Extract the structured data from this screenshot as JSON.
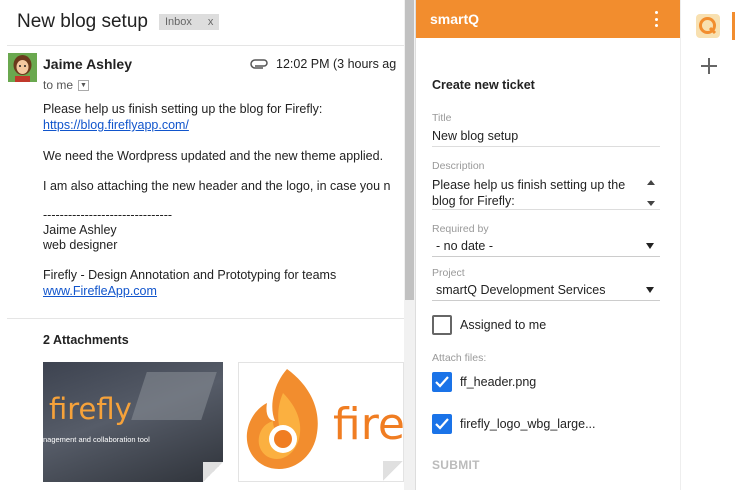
{
  "email": {
    "subject": "New blog setup",
    "label_chip": "Inbox",
    "label_remove": "x",
    "sender": "Jaime Ashley",
    "recipient": "to me",
    "time": "12:02 PM (3 hours ag",
    "body": {
      "line1": "Please help us finish setting up the blog for Firefly:",
      "link1": "https://blog.fireflyapp.com/",
      "line2": "We need the Wordpress updated and the new theme applied.",
      "line3": "I am also attaching the new header and the logo, in case you n",
      "sig_rule": "-------------------------------",
      "sig_name": "Jaime Ashley",
      "sig_role": "web designer",
      "sig_company": "Firefly - Design Annotation and Prototyping for teams",
      "sig_link": "www.FirefleApp.com"
    },
    "attachments_title": "2 Attachments",
    "attachment1": {
      "word": "firefly",
      "tagline": "nagement and collaboration tool"
    },
    "attachment2": {
      "word": "fire"
    }
  },
  "panel": {
    "app_name": "smartQ",
    "section_title": "Create new ticket",
    "title_label": "Title",
    "title_value": "New blog setup",
    "description_label": "Description",
    "description_value": "Please help us finish setting up the blog for Firefly:",
    "required_label": "Required by",
    "required_value": "- no date -",
    "project_label": "Project",
    "project_value": "smartQ Development Services",
    "assigned_label": "Assigned to me",
    "assigned_checked": false,
    "attach_label": "Attach files:",
    "files": [
      {
        "name": "ff_header.png",
        "checked": true
      },
      {
        "name": "firefly_logo_wbg_large...",
        "checked": true
      }
    ],
    "submit_label": "SUBMIT",
    "accent_color": "#f28d2e",
    "check_color": "#1a73e8"
  },
  "rail": {
    "app_icon": "smartq-app-icon",
    "add_icon": "plus-icon"
  }
}
